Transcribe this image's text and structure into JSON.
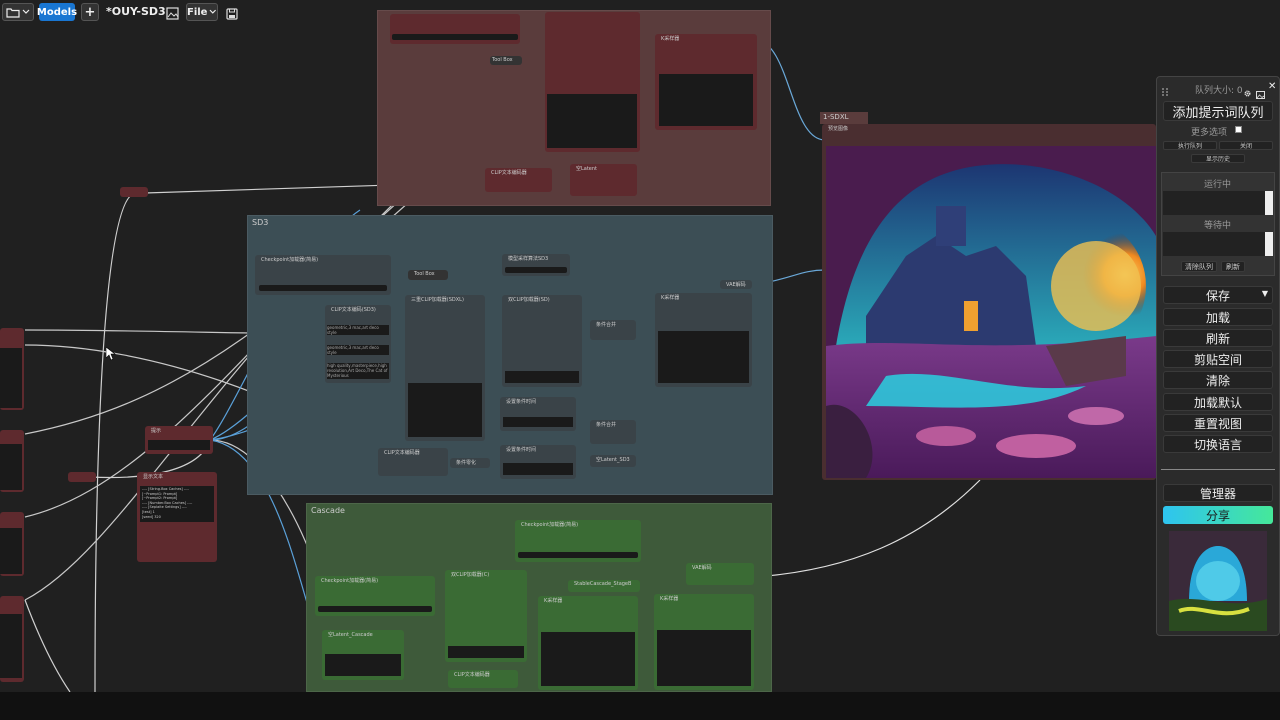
{
  "toolbar": {
    "models_label": "Models",
    "add_label": "+",
    "workflow_name": "*OUY-SD3",
    "file_label": "File"
  },
  "groups": {
    "sd3": "SD3",
    "cascade": "Cascade",
    "sdxl_tag": "1-SDXL"
  },
  "nodes": {
    "top_tool": "Tool Box",
    "top_ksampler": "K采样器",
    "top_clip_encode": "CLIP文本编码器",
    "top_latent": "空Latent",
    "sd3_checkpoint": "Checkpoint加载器(简易)",
    "sd3_clip": "CLIP文本编码(SD3)",
    "sd3_model_sampling": "模型采样算法SD3",
    "sd3_tool": "Tool Box",
    "sd3_tripleclip": "三重CLIP加载器(SDXL)",
    "sd3_dualclip": "双CLIP加载器(SD)",
    "sd3_ksampler": "K采样器",
    "sd3_vae": "VAE解码",
    "sd3_cond_combine1": "条件合并",
    "sd3_cond_combine2": "条件合并",
    "sd3_cond_range1": "设置条件时间",
    "sd3_cond_range2": "设置条件时间",
    "sd3_latent": "空Latent_SD3",
    "sd3_clip_encode": "CLIP文本编码器",
    "sd3_cond_zero": "条件零化",
    "sd3_prompt1": "geometric,3 mac,art deco style",
    "sd3_prompt2": "geometric,3 mac,art deco style",
    "sd3_prompt3": "high quality,masterpiece,high resolution,Art Deco,The Cat of Mysterious",
    "cascade_checkpoint1": "Checkpoint加载器(简易)",
    "cascade_checkpoint2": "Checkpoint加载器(简易)",
    "cascade_dualclip": "双CLIP加载器(C)",
    "cascade_stage_b": "StableCascade_StageB",
    "cascade_vae": "VAE解码",
    "cascade_ksampler1": "K采样器",
    "cascade_ksampler2": "K采样器",
    "cascade_latent": "空Latent_Cascade",
    "cascade_clip_encode": "CLIP文本编码器",
    "left_note": "提示",
    "left_show_text": "显示文本",
    "preview_node": "预览图像",
    "left_text_lines": [
      "---- [String.Box Caches] ----",
      "[~Prompt1: Prompt]",
      "[~Prompt2: Prompt]",
      "---- [Number.Box Caches] ----",
      "---- [Seplaite Settings] ----",
      "[test] 1",
      "[seed] 320"
    ]
  },
  "panel": {
    "queue_size": "队列大小: 0",
    "queue_prompt": "添加提示词队列",
    "extra_options": "更多选项",
    "run_queue": "执行队列",
    "close": "关闭",
    "show_history": "显示历史",
    "running": "运行中",
    "pending": "等待中",
    "clear_queue": "清除队列",
    "refresh_small": "刷新",
    "save": "保存",
    "load": "加载",
    "refresh": "刷新",
    "clipspace": "剪贴空间",
    "clear": "清除",
    "load_default": "加载默认",
    "reset_view": "重置视图",
    "switch_lang": "切换语言",
    "manager": "管理器",
    "share": "分享"
  },
  "colors": {
    "accent_blue": "#1976d2",
    "share_gradient_start": "#2ec4f0",
    "share_gradient_end": "#45e89a",
    "group_red": "#5a3c3c",
    "group_blue": "#3c4e55",
    "group_green": "#3e5a3a"
  },
  "icons": {
    "folder": "folder-icon",
    "image": "image-icon",
    "save": "save-icon",
    "gear": "gear-icon",
    "close": "close-icon",
    "grip": "grip-icon"
  }
}
